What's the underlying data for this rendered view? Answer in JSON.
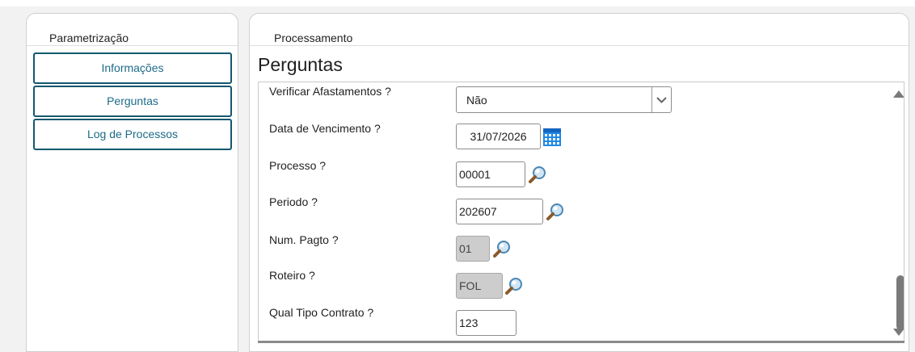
{
  "left": {
    "header": "Parametrização",
    "menu": [
      {
        "label": "Informações"
      },
      {
        "label": "Perguntas"
      },
      {
        "label": "Log de Processos"
      }
    ]
  },
  "right": {
    "header": "Processamento",
    "title": "Perguntas",
    "questions": {
      "afastamentos": {
        "label": "Verificar Afastamentos ?",
        "value": "Não"
      },
      "vencimento": {
        "label": "Data de Vencimento ?",
        "value": "31/07/2026"
      },
      "processo": {
        "label": "Processo ?",
        "value": "00001"
      },
      "periodo": {
        "label": "Periodo ?",
        "value": "202607"
      },
      "num_pagto": {
        "label": "Num. Pagto ?",
        "value": "01"
      },
      "roteiro": {
        "label": "Roteiro ?",
        "value": "FOL"
      },
      "tipo_contrato": {
        "label": "Qual Tipo Contrato ?",
        "value": "123"
      }
    }
  },
  "icons": {
    "lookup": "search-lens-icon",
    "calendar": "calendar-icon",
    "dropdown": "chevron-down-icon",
    "scroll_up": "scroll-up-icon",
    "scroll_down": "scroll-down-icon"
  },
  "colors": {
    "menu_border": "#14586f",
    "menu_text": "#1c6b89",
    "calendar": "#1e88e5",
    "readonly_bg": "#cdcdcd"
  }
}
